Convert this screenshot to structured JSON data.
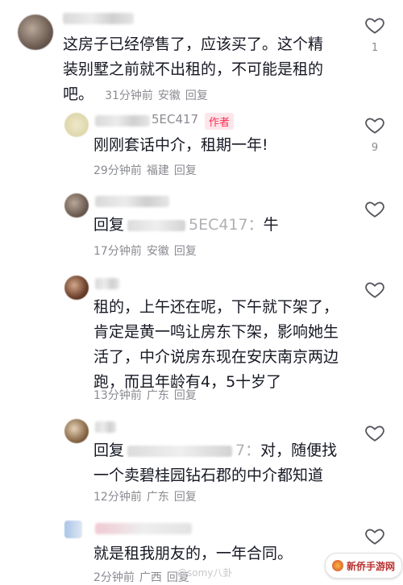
{
  "comments": [
    {
      "text_lines": [
        "这房子已经停售了，应该买了。这个精",
        "装别墅之前就不出租的，不可能是租的",
        "吧。"
      ],
      "time": "31分钟前",
      "location": "安徽",
      "reply_label": "回复",
      "likes": "1"
    },
    {
      "name_suffix": "5EC417",
      "author_tag": "作者",
      "text_lines": [
        "刚刚套话中介，租期一年!"
      ],
      "time": "29分钟前",
      "location": "福建",
      "reply_label": "回复",
      "likes": "9"
    },
    {
      "reply_prefix": "回复",
      "reply_target_suffix": "5EC417：",
      "text_after": "牛",
      "time": "17分钟前",
      "location": "安徽",
      "reply_label": "回复"
    },
    {
      "text_lines": [
        "租的，上午还在呢，下午就下架了，",
        "肯定是黄一鸣让房东下架，影响她生",
        "活了，中介说房东现在安庆南京两边",
        "跑，而且年龄有4，5十岁了"
      ],
      "time": "13分钟前",
      "location": "广东",
      "reply_label": "回复"
    },
    {
      "reply_prefix": "回复",
      "reply_target_suffix": "7：",
      "text_after": "对，随便找",
      "text_line2": "一个卖碧桂园钻石郡的中介都知道",
      "time": "12分钟前",
      "location": "广东",
      "reply_label": "回复"
    },
    {
      "text_lines": [
        "就是租我朋友的，一年合同。"
      ],
      "time": "2分钟前",
      "location": "广西",
      "reply_label": "回复"
    }
  ],
  "watermark": "@somy八卦",
  "site_badge": "新侨手游网"
}
